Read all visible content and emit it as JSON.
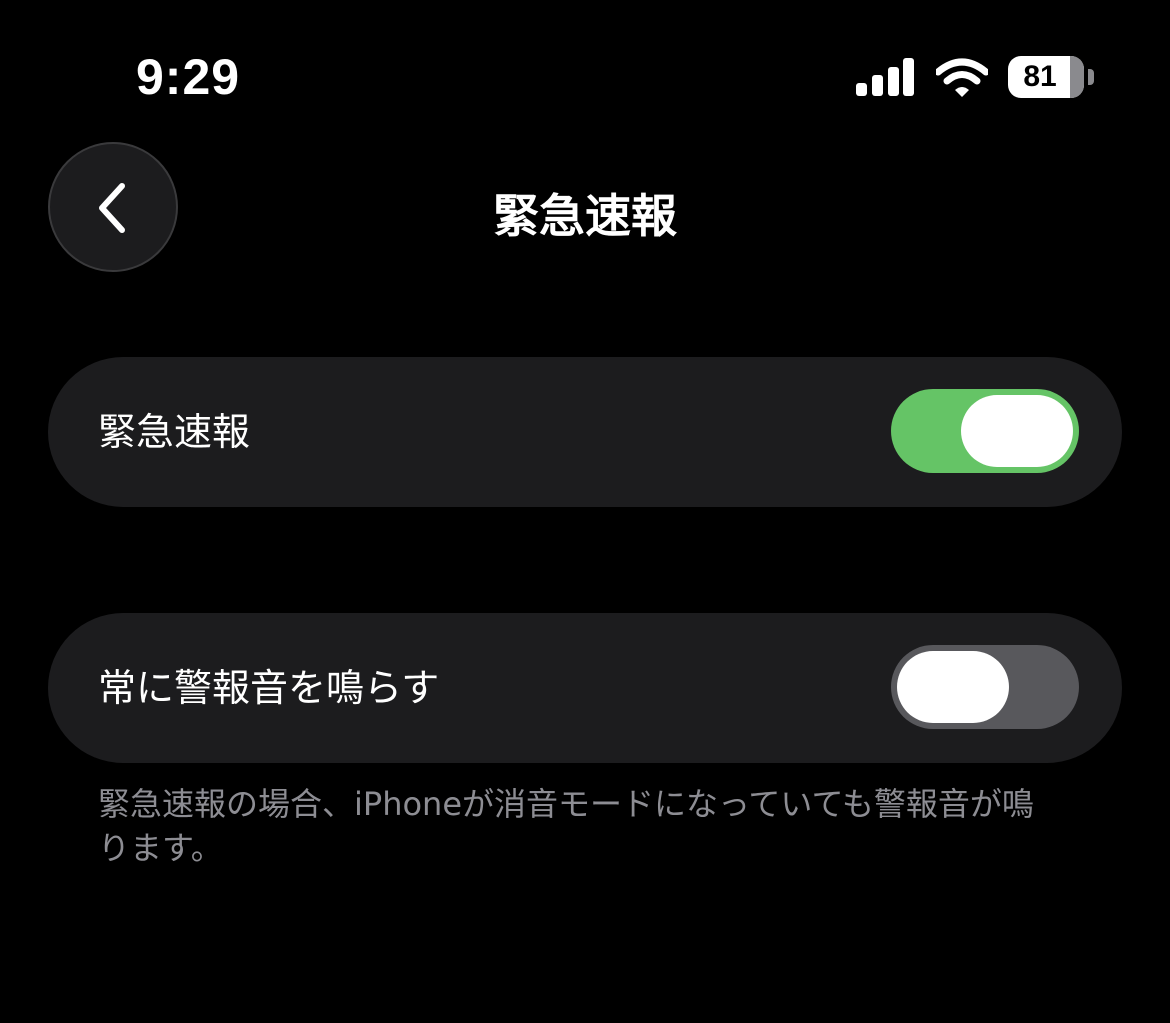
{
  "status_bar": {
    "time": "9:29",
    "battery_level": "81",
    "battery_fraction": 0.81,
    "signal_icon": "cellular-signal-icon",
    "wifi_icon": "wifi-icon",
    "battery_icon": "battery-icon"
  },
  "nav": {
    "title": "緊急速報",
    "back_icon": "chevron-left-icon"
  },
  "settings": [
    {
      "label": "緊急速報",
      "enabled": true
    },
    {
      "label": "常に警報音を鳴らす",
      "enabled": false
    }
  ],
  "footer_note": "緊急速報の場合、iPhoneが消音モードになっていても警報音が鳴ります。",
  "colors": {
    "background": "#000000",
    "cell_background": "#1c1c1e",
    "toggle_on": "#65c466",
    "toggle_off": "#58585c",
    "secondary_text": "#8d8d93"
  }
}
